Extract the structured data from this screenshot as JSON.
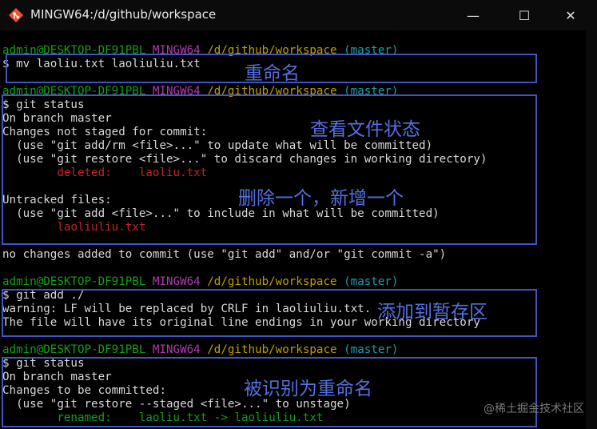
{
  "window": {
    "title": "MINGW64:/d/github/workspace",
    "minimize_glyph": "—",
    "maximize_glyph": "☐",
    "close_glyph": "✕"
  },
  "terminal": {
    "prompt": {
      "user_host": "admin@DESKTOP-DF91PBL",
      "env": "MINGW64",
      "path": "/d/github/workspace",
      "branch": "(master)"
    },
    "lines": {
      "cmd1": "$ mv laoliu.txt laoliuliu.txt",
      "cmd2": "$ git status",
      "s_branch": "On branch master",
      "s_not_staged": "Changes not staged for commit:",
      "s_hint1": "  (use \"git add/rm <file>...\" to update what will be committed)",
      "s_hint2": "  (use \"git restore <file>...\" to discard changes in working directory)",
      "s_deleted": "        deleted:    laoliu.txt",
      "s_untracked": "Untracked files:",
      "s_hint3": "  (use \"git add <file>...\" to include in what will be committed)",
      "s_untracked_file": "        laoliuliu.txt",
      "s_nochanges": "no changes added to commit (use \"git add\" and/or \"git commit -a\")",
      "cmd3": "$ git add ./",
      "w1": "warning: LF will be replaced by CRLF in laoliuliu.txt.",
      "w2": "The file will have its original line endings in your working directory",
      "cmd4": "$ git status",
      "s2_branch": "On branch master",
      "s2_tobecommitted": "Changes to be committed:",
      "s2_hint": "  (use \"git restore --staged <file>...\" to unstage)",
      "s2_renamed": "        renamed:    laoliu.txt -> laoliuliu.txt"
    }
  },
  "annotations": {
    "rename": "重命名",
    "check_status": "查看文件状态",
    "delete_add": "删除一个，新增一个",
    "add_staging": "添加到暂存区",
    "recognized_rename": "被识别为重命名"
  },
  "watermark": "@稀土掘金技术社区",
  "colors": {
    "prompt_user": "#12a012",
    "prompt_env": "#b13ab1",
    "prompt_path": "#c0a000",
    "prompt_branch": "#1f9db0",
    "status_red": "#c52424",
    "annotation": "#3f55c4"
  }
}
